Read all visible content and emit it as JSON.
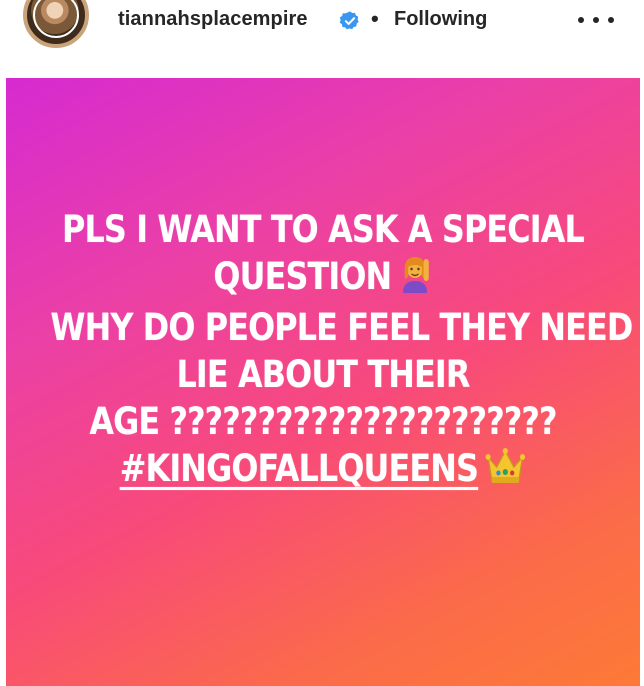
{
  "header": {
    "username": "tiannahsplacempire",
    "separator": "•",
    "follow_status": "Following",
    "verified_icon": "verified-badge-icon",
    "more_icon": "more-options-icon",
    "colors": {
      "verified": "#3897f0",
      "text": "#262626"
    }
  },
  "story": {
    "line1": "PLS I WANT TO ASK A SPECIAL",
    "line2": "QUESTION",
    "line3": "WHY DO PEOPLE FEEL THEY NEED TO",
    "line4": "LIE ABOUT THEIR",
    "line5": "AGE ??????????????????????",
    "hashtag": "#KINGOFALLQUEENS",
    "emoji_raise_hand": "raising-hand-woman-icon",
    "emoji_crown": "crown-icon",
    "gradient": [
      "#d62ad1",
      "#ea3fa8",
      "#f84a7a",
      "#fb6a4a",
      "#fd7a36"
    ]
  }
}
